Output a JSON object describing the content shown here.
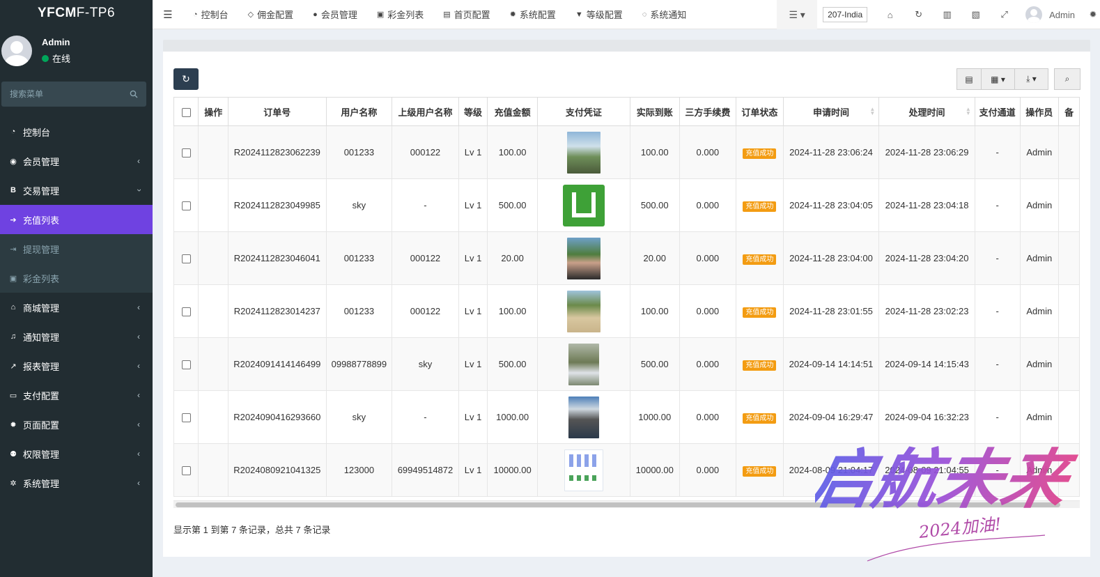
{
  "brand": {
    "bold": "YFCM",
    "rest": "F-TP6"
  },
  "user": {
    "name": "Admin",
    "status": "在线"
  },
  "search": {
    "placeholder": "搜索菜单"
  },
  "sidebar": {
    "items": [
      {
        "label": "控制台",
        "icon": "dashboard-icon"
      },
      {
        "label": "会员管理",
        "icon": "user-circle-icon"
      },
      {
        "label": "交易管理",
        "icon": "bitcoin-icon"
      },
      {
        "label": "商城管理",
        "icon": "home-icon"
      },
      {
        "label": "通知管理",
        "icon": "bell-icon"
      },
      {
        "label": "报表管理",
        "icon": "line-chart-icon"
      },
      {
        "label": "支付配置",
        "icon": "credit-card-icon"
      },
      {
        "label": "页面配置",
        "icon": "gear-icon"
      },
      {
        "label": "权限管理",
        "icon": "users-icon"
      },
      {
        "label": "系统管理",
        "icon": "gears-icon"
      }
    ],
    "submenu": [
      {
        "label": "充值列表",
        "icon": "sign-in-icon",
        "active": true
      },
      {
        "label": "提现管理",
        "icon": "sign-out-icon"
      },
      {
        "label": "彩金列表",
        "icon": "gift-icon"
      }
    ]
  },
  "topnav": {
    "items": [
      {
        "label": "控制台",
        "icon": "dashboard-icon"
      },
      {
        "label": "佣金配置",
        "icon": "diamond-icon"
      },
      {
        "label": "会员管理",
        "icon": "user-icon"
      },
      {
        "label": "彩金列表",
        "icon": "gift-icon"
      },
      {
        "label": "首页配置",
        "icon": "h-square-icon"
      },
      {
        "label": "系统配置",
        "icon": "gear-icon"
      },
      {
        "label": "等级配置",
        "icon": "vimeo-icon"
      },
      {
        "label": "系统通知",
        "icon": "comments-icon"
      }
    ],
    "site_select": "207-India",
    "admin": "Admin"
  },
  "table": {
    "headers": [
      "操作",
      "订单号",
      "用户名称",
      "上级用户名称",
      "等级",
      "充值金额",
      "支付凭证",
      "实际到账",
      "三方手续费",
      "订单状态",
      "申请时间",
      "处理时间",
      "支付通道",
      "操作员",
      "备"
    ],
    "rows": [
      {
        "order": "R2024112823062239",
        "user": "001233",
        "parent": "000122",
        "level": "Lv 1",
        "amount": "100.00",
        "thumb": "t1",
        "actual": "100.00",
        "fee": "0.000",
        "status": "充值成功",
        "apply": "2024-11-28 23:06:24",
        "process": "2024-11-28 23:06:29",
        "channel": "-",
        "operator": "Admin"
      },
      {
        "order": "R2024112823049985",
        "user": "sky",
        "parent": "-",
        "level": "Lv 1",
        "amount": "500.00",
        "thumb": "t2",
        "actual": "500.00",
        "fee": "0.000",
        "status": "充值成功",
        "apply": "2024-11-28 23:04:05",
        "process": "2024-11-28 23:04:18",
        "channel": "-",
        "operator": "Admin"
      },
      {
        "order": "R2024112823046041",
        "user": "001233",
        "parent": "000122",
        "level": "Lv 1",
        "amount": "20.00",
        "thumb": "t3",
        "actual": "20.00",
        "fee": "0.000",
        "status": "充值成功",
        "apply": "2024-11-28 23:04:00",
        "process": "2024-11-28 23:04:20",
        "channel": "-",
        "operator": "Admin"
      },
      {
        "order": "R2024112823014237",
        "user": "001233",
        "parent": "000122",
        "level": "Lv 1",
        "amount": "100.00",
        "thumb": "t4",
        "actual": "100.00",
        "fee": "0.000",
        "status": "充值成功",
        "apply": "2024-11-28 23:01:55",
        "process": "2024-11-28 23:02:23",
        "channel": "-",
        "operator": "Admin"
      },
      {
        "order": "R2024091414146499",
        "user": "09988778899",
        "parent": "sky",
        "level": "Lv 1",
        "amount": "500.00",
        "thumb": "t5",
        "actual": "500.00",
        "fee": "0.000",
        "status": "充值成功",
        "apply": "2024-09-14 14:14:51",
        "process": "2024-09-14 14:15:43",
        "channel": "-",
        "operator": "Admin"
      },
      {
        "order": "R2024090416293660",
        "user": "sky",
        "parent": "-",
        "level": "Lv 1",
        "amount": "1000.00",
        "thumb": "t6",
        "actual": "1000.00",
        "fee": "0.000",
        "status": "充值成功",
        "apply": "2024-09-04 16:29:47",
        "process": "2024-09-04 16:32:23",
        "channel": "-",
        "operator": "Admin"
      },
      {
        "order": "R2024080921041325",
        "user": "123000",
        "parent": "69949514872",
        "level": "Lv 1",
        "amount": "10000.00",
        "thumb": "t7",
        "actual": "10000.00",
        "fee": "0.000",
        "status": "充值成功",
        "apply": "2024-08-09 21:04:17",
        "process": "2024-08-09 21:04:55",
        "channel": "-",
        "operator": "Admin"
      }
    ]
  },
  "pager": {
    "info": "显示第 1 到第 7 条记录，总共 7 条记录"
  },
  "watermark": {
    "main": "启航未来",
    "sub": "2024加油!"
  },
  "colors": {
    "sidebar_bg": "#222d32",
    "active": "#6f42e1",
    "badge": "#f39c12",
    "online": "#00a65a"
  }
}
